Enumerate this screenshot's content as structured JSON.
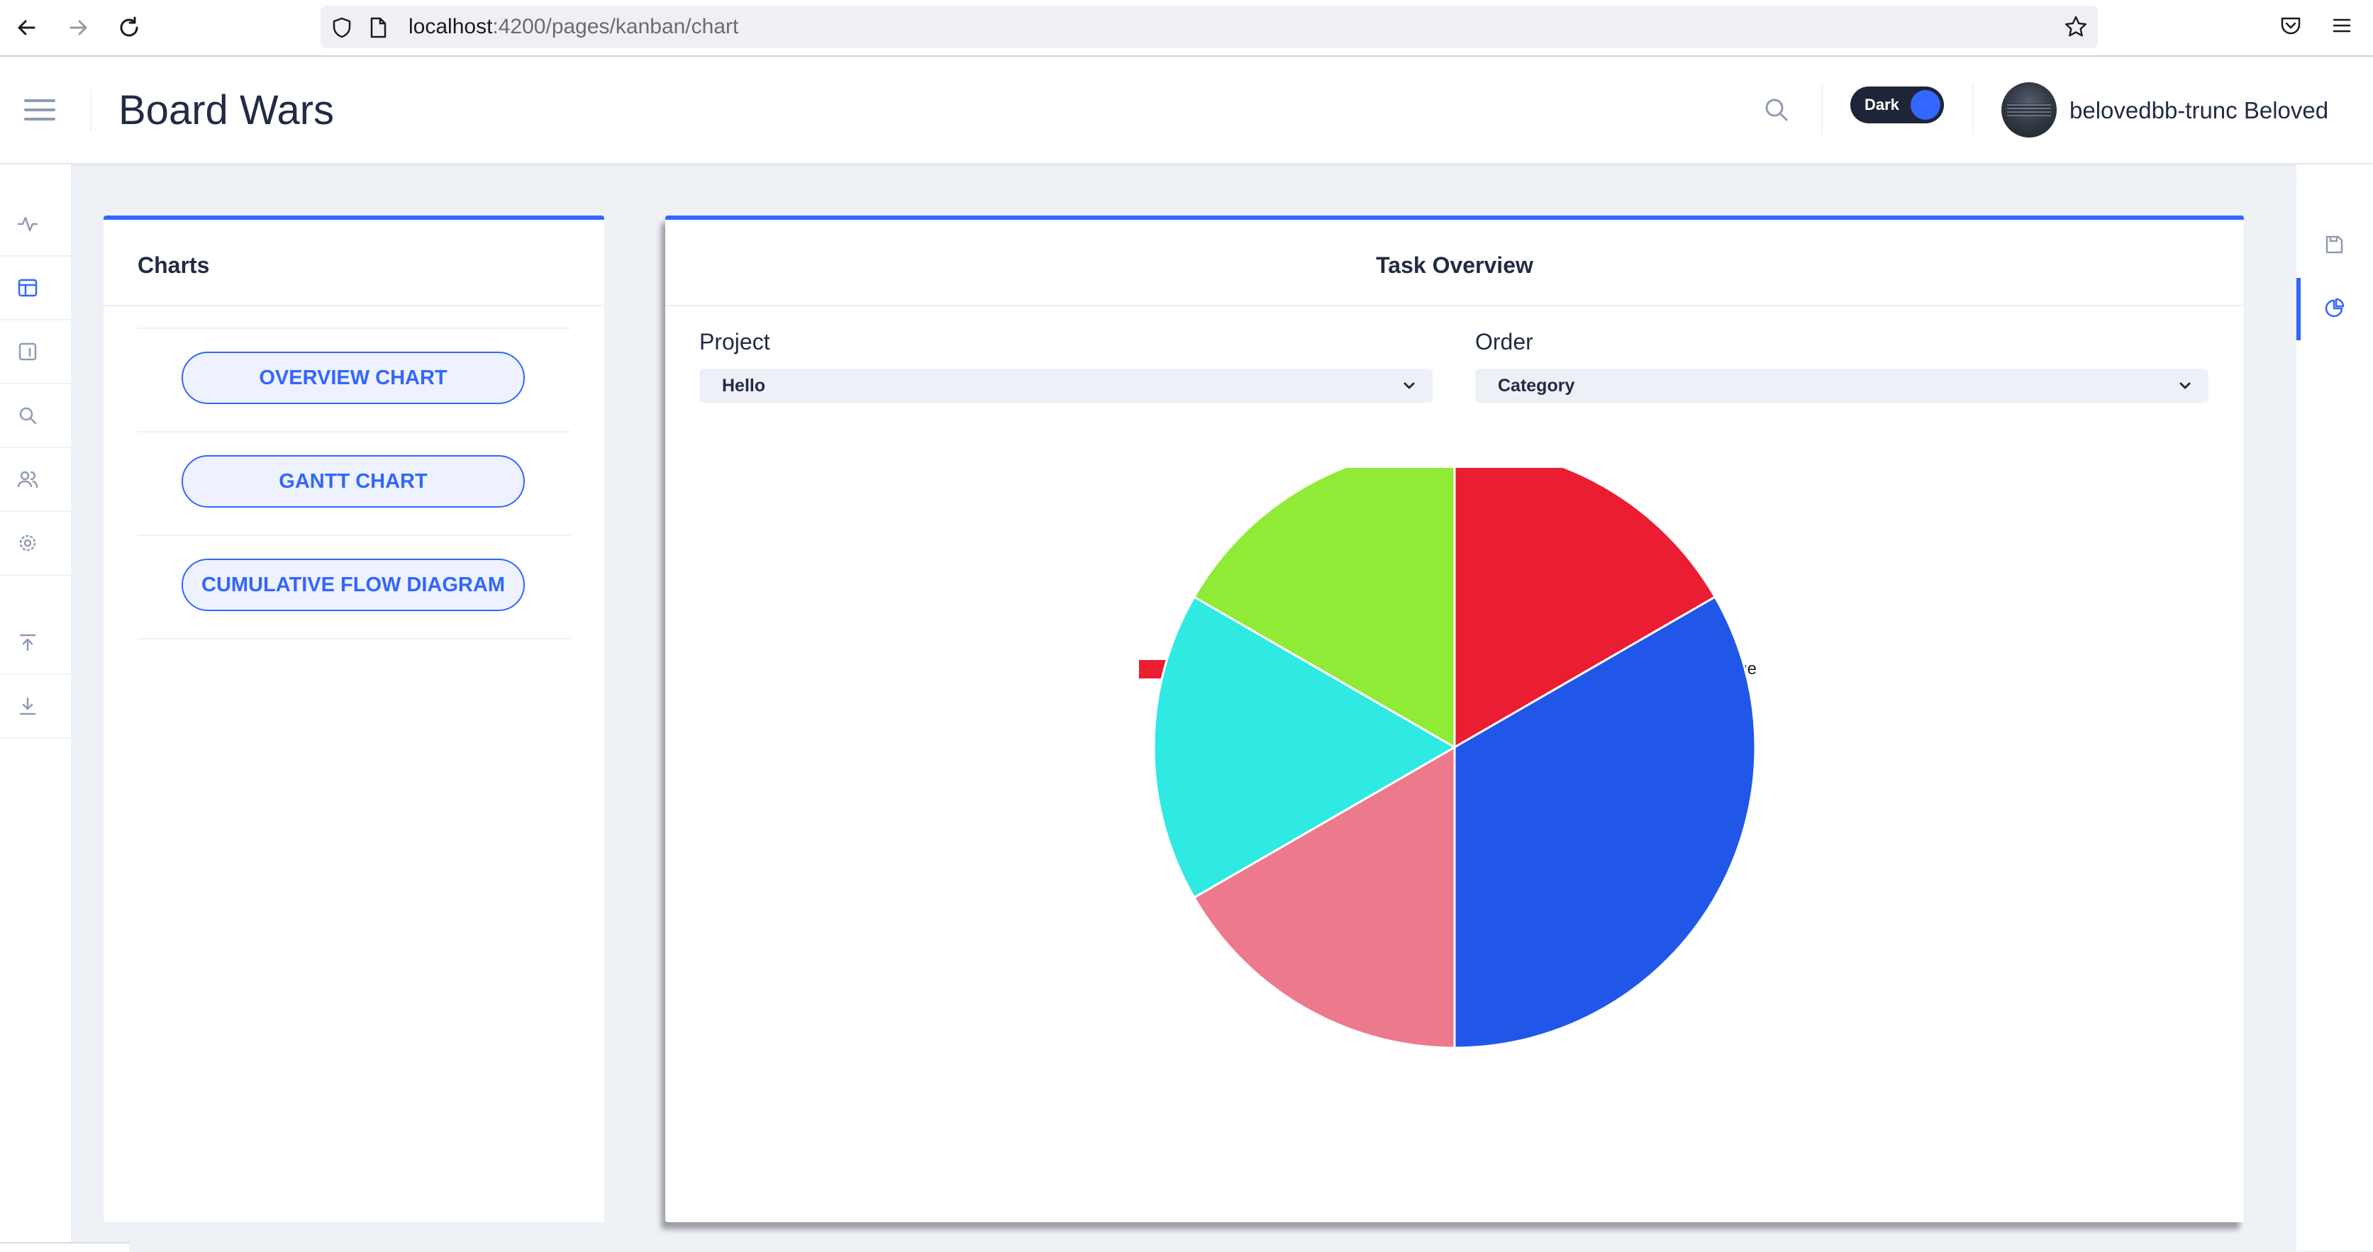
{
  "browser": {
    "url_host": "localhost",
    "url_rest": ":4200/pages/kanban/chart",
    "icons": [
      "back-icon",
      "forward-icon",
      "reload-icon",
      "shield-icon",
      "page-icon",
      "star-icon",
      "pocket-icon",
      "menu-icon"
    ]
  },
  "header": {
    "title": "Board Wars",
    "theme_toggle_label": "Dark",
    "username": "belovedbb-trunc Beloved"
  },
  "sidebar_icons": [
    "activity-icon",
    "layout-icon",
    "board-icon",
    "search-icon",
    "users-icon",
    "settings-icon",
    "upload-icon",
    "download-icon"
  ],
  "right_rail_icons": [
    "save-icon",
    "pie-chart-icon"
  ],
  "charts_panel": {
    "title": "Charts",
    "buttons": [
      "OVERVIEW CHART",
      "GANTT CHART",
      "CUMULATIVE FLOW DIAGRAM"
    ]
  },
  "task_overview": {
    "title": "Task Overview",
    "project_label": "Project",
    "project_value": "Hello",
    "order_label": "Order",
    "order_value": "Category"
  },
  "colors": {
    "accent": "#3366ff",
    "danger": "#eb1d32",
    "low": "#2157e8",
    "high": "#ec7a8c",
    "subtle": "#2eeae2",
    "average": "#8feb36"
  },
  "chart_data": {
    "type": "pie",
    "categories": [
      "Danger",
      "Low",
      "High",
      "Subtle",
      "Average"
    ],
    "values": [
      1,
      2,
      1,
      1,
      1
    ],
    "colors": [
      "#eb1d32",
      "#2157e8",
      "#ec7a8c",
      "#2eeae2",
      "#8feb36"
    ],
    "legend_position": "top"
  }
}
